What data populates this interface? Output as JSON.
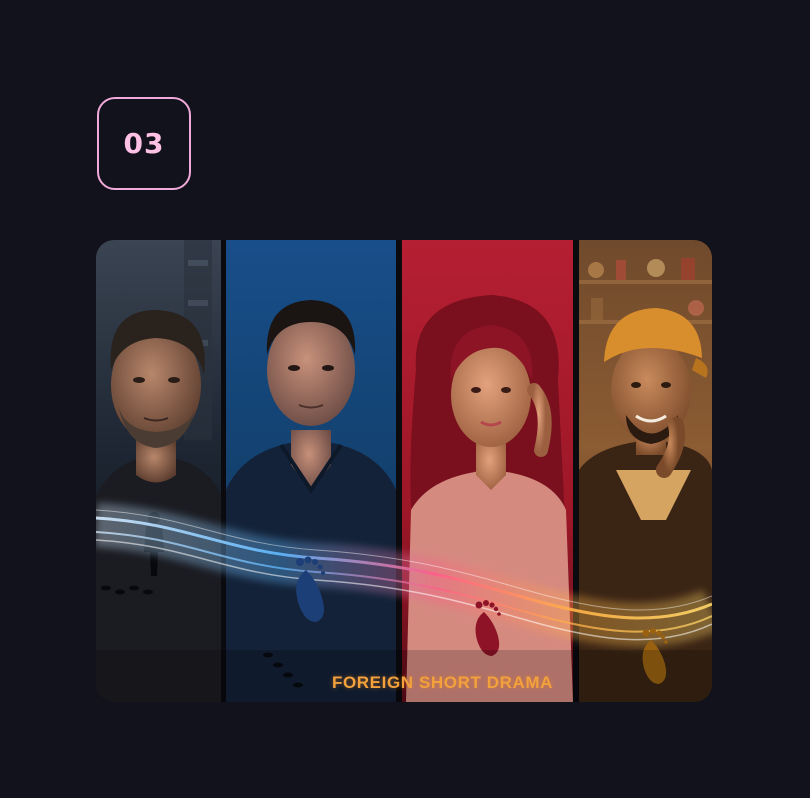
{
  "step": {
    "number": "03"
  },
  "banner": {
    "caption": "FOREIGN SHORT DRAMA",
    "panels": [
      {
        "description": "man with grey stubble, dark night city",
        "tone": "#27384a"
      },
      {
        "description": "man in dark shirt, blue studio",
        "tone": "#1c4a87"
      },
      {
        "description": "woman with red hair, red background",
        "tone": "#ab1c30"
      },
      {
        "description": "smiling man in orange cap, warm room",
        "tone": "#6a3c1d"
      }
    ],
    "colors": {
      "badge_border": "#f0a9d8",
      "badge_text": "#ffc1e6",
      "caption": "#f3a13c",
      "page_background": "#12121c"
    }
  }
}
